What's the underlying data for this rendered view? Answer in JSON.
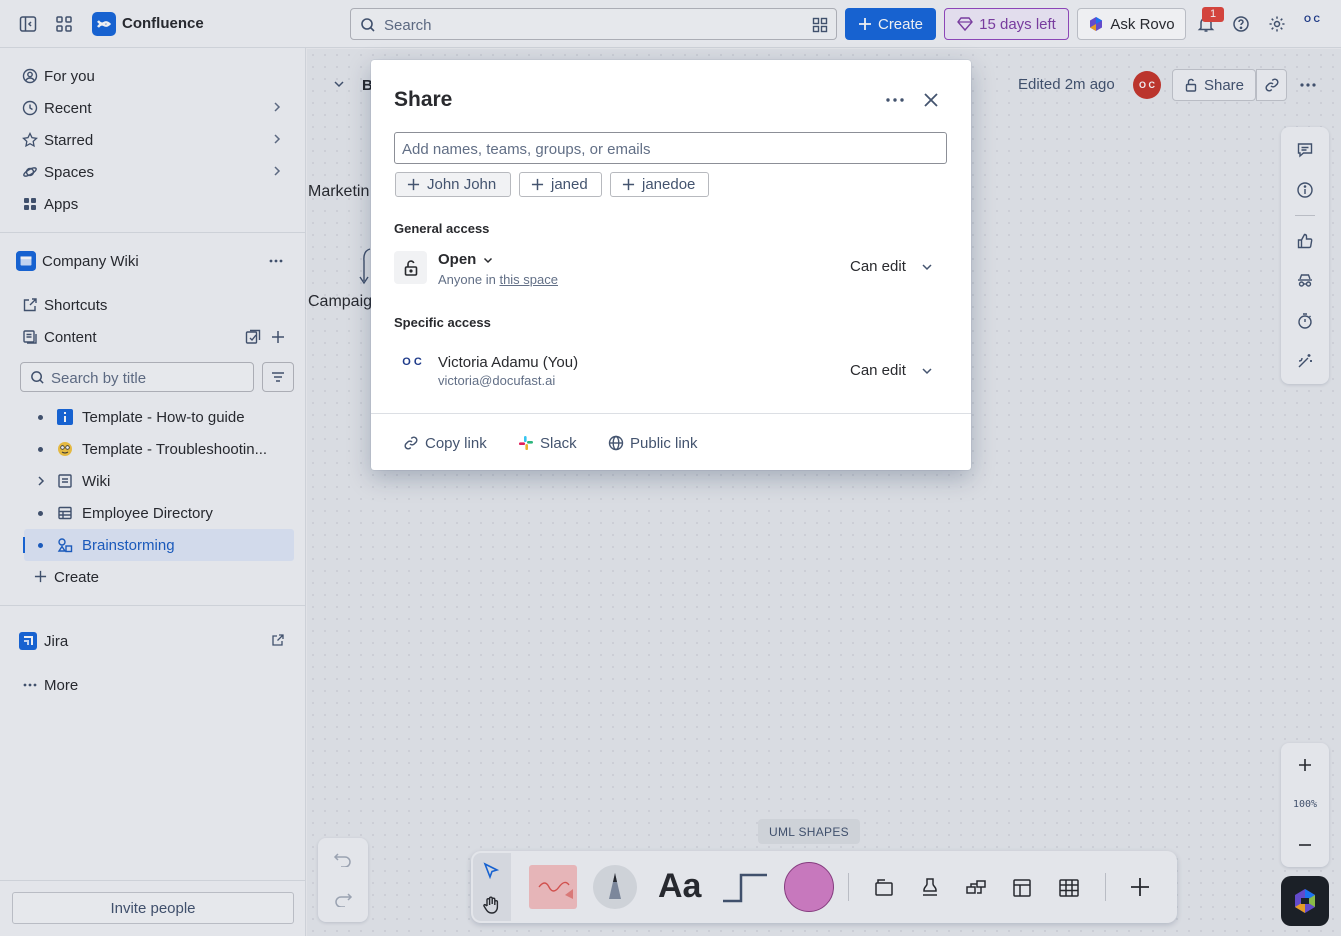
{
  "app": {
    "name": "Confluence"
  },
  "topbar": {
    "search_placeholder": "Search",
    "create_label": "Create",
    "trial_label": "15 days left",
    "rovo_label": "Ask Rovo",
    "notification_count": "1"
  },
  "sidebar": {
    "nav": [
      {
        "label": "For you"
      },
      {
        "label": "Recent"
      },
      {
        "label": "Starred"
      },
      {
        "label": "Spaces"
      },
      {
        "label": "Apps"
      }
    ],
    "space_name": "Company Wiki",
    "shortcuts_label": "Shortcuts",
    "content_label": "Content",
    "search_placeholder": "Search by title",
    "tree": [
      {
        "label": "Template - How-to guide"
      },
      {
        "label": "Template - Troubleshootin..."
      },
      {
        "label": "Wiki"
      },
      {
        "label": "Employee Directory"
      },
      {
        "label": "Brainstorming"
      }
    ],
    "create_label": "Create",
    "jira_label": "Jira",
    "more_label": "More",
    "invite_label": "Invite people"
  },
  "page": {
    "edited_label": "Edited 2m ago",
    "share_label": "Share",
    "title_initial": "B",
    "avatar_text": "O C",
    "canvas_labels": [
      "Marketin",
      "Campaig"
    ],
    "zoom_level": "100%",
    "uml_tag": "UML SHAPES"
  },
  "share_modal": {
    "title": "Share",
    "input_placeholder": "Add names, teams, groups, or emails",
    "suggestions": [
      {
        "label": "John John"
      },
      {
        "label": "janed"
      },
      {
        "label": "janedoe"
      }
    ],
    "general_access_title": "General access",
    "access_mode": "Open",
    "access_desc_prefix": "Anyone in",
    "access_desc_link": "this space",
    "general_permission": "Can edit",
    "specific_access_title": "Specific access",
    "user_name": "Victoria Adamu (You)",
    "user_email": "victoria@docufast.ai",
    "user_permission": "Can edit",
    "user_avatar_text": "O C",
    "footer": {
      "copy_link": "Copy link",
      "slack": "Slack",
      "public_link": "Public link"
    }
  },
  "colors": {
    "brand": "#1868db",
    "trial": "#803fa5",
    "active_bg": "#e1e9f8",
    "badge": "#e2483d"
  }
}
